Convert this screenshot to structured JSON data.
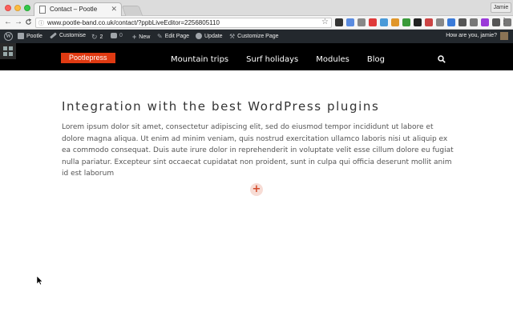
{
  "browser": {
    "tab_title": "Contact – Pootle",
    "tab_close": "✕",
    "profile_name": "Jamie",
    "url_host": "www.pootle-band.co.uk",
    "url_path": "/contact/?ppbLiveEditor=2256805110",
    "back_icon": "←",
    "forward_icon": "→",
    "reload_icon": "C",
    "star_icon": "☆",
    "menu_icon": "⋮",
    "lock_icon": "ⓘ",
    "extension_colors": [
      "#333333",
      "#5a8be0",
      "#888888",
      "#e03a3a",
      "#4a9ad8",
      "#e0962a",
      "#3a9a3a",
      "#222222",
      "#cc4444",
      "#888888",
      "#3a7ad8",
      "#555555",
      "#777777",
      "#9a3ad8",
      "#555555",
      "#777777",
      "#9a9a9a"
    ]
  },
  "adminbar": {
    "wp_logo": "W",
    "site_name": "Pootle",
    "customise": "Customise",
    "updates_count": "2",
    "comments_count": "0",
    "new": "New",
    "edit_page": "Edit Page",
    "update": "Update",
    "customize_page": "Customize Page",
    "greeting": "How are you, jamie?"
  },
  "site": {
    "logo": "Pootlepress",
    "nav": [
      "Mountain trips",
      "Surf holidays",
      "Modules",
      "Blog"
    ]
  },
  "content": {
    "heading": "Integration with the best WordPress plugins",
    "paragraph": "Lorem ipsum dolor sit amet, consectetur adipiscing elit, sed do eiusmod tempor incididunt ut labore et dolore magna aliqua. Ut enim ad minim veniam, quis nostrud exercitation ullamco laboris nisi ut aliquip ex ea commodo consequat. Duis aute irure dolor in reprehenderit in voluptate velit esse cillum dolore eu fugiat nulla pariatur. Excepteur sint occaecat cupidatat non proident, sunt in culpa qui officia deserunt mollit anim id est laborum",
    "add_symbol": "+"
  }
}
